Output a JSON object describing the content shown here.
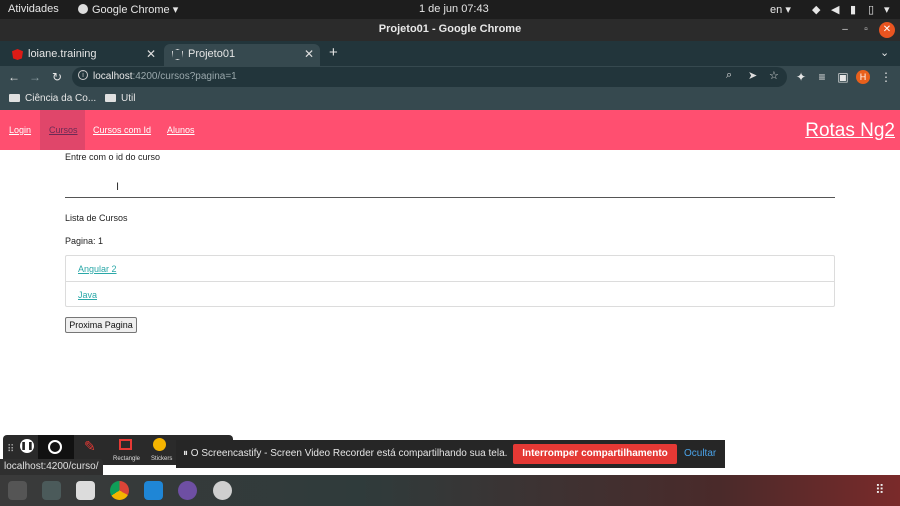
{
  "system": {
    "activities": "Atividades",
    "app_menu": "Google Chrome",
    "clock": "1 de jun  07:43",
    "lang": "en"
  },
  "window": {
    "title": "Projeto01 - Google Chrome"
  },
  "tabs": [
    {
      "label": "loiane.training"
    },
    {
      "label": "Projeto01"
    }
  ],
  "address_bar": {
    "host": "localhost",
    "path": ":4200/cursos?pagina=1"
  },
  "profile_initial": "H",
  "bookmarks": [
    {
      "label": "Ciência da Co..."
    },
    {
      "label": "Util"
    }
  ],
  "app_nav": {
    "links": [
      {
        "label": "Login"
      },
      {
        "label": "Cursos"
      },
      {
        "label": "Cursos com Id"
      },
      {
        "label": "Alunos"
      }
    ],
    "active_index": 1,
    "brand": "Rotas Ng2"
  },
  "content": {
    "id_label": "Entre com o id do curso",
    "list_title": "Lista de Cursos",
    "page_label": "Pagina: 1",
    "courses": [
      "Angular 2",
      "Java"
    ],
    "next_button": "Proxima Pagina"
  },
  "screencastify": {
    "tools": [
      "Rectangle",
      "Stickers"
    ],
    "message": "O Screencastify - Screen Video Recorder está compartilhando sua tela.",
    "stop_button": "Interromper compartilhamento",
    "hide_link": "Ocultar"
  },
  "status_url": "localhost:4200/curso/",
  "colors": {
    "navbar": "#ff4f70",
    "link": "#2aa8a8",
    "stop": "#e53935"
  }
}
